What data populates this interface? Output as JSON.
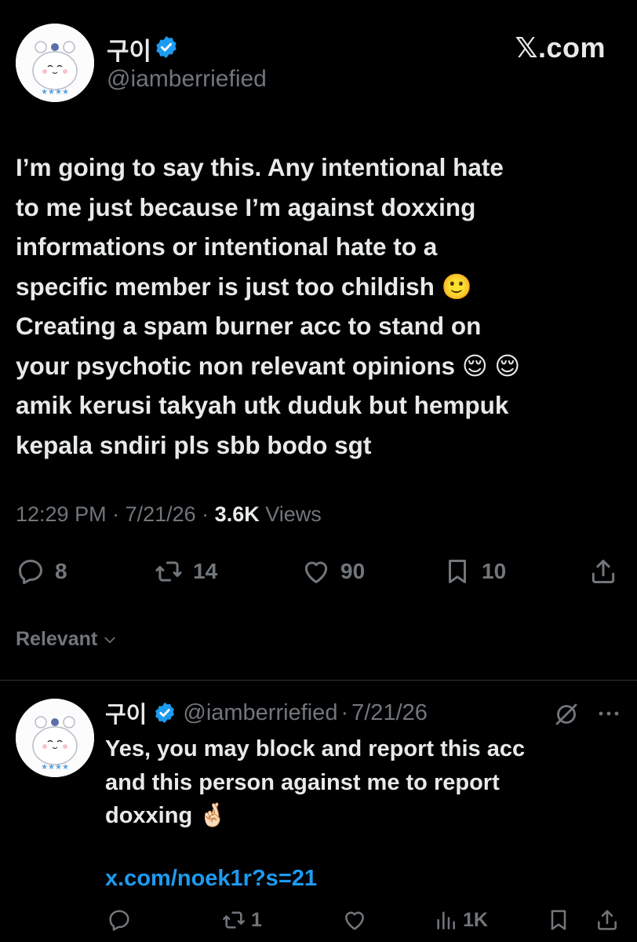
{
  "colors": {
    "background": "#000000",
    "text_primary": "#e7e9ea",
    "text_secondary": "#71767b",
    "verified_blue": "#1d9bf0",
    "link_blue": "#1d9bf0",
    "divider": "#2f3336"
  },
  "header": {
    "brand": "𝕏.com",
    "user": {
      "display_name": "구이",
      "handle": "@iamberriefied",
      "avatar_icon": "bear-avatar-icon",
      "verified_icon": "verified-badge-icon"
    }
  },
  "tweet": {
    "lines": [
      "I’m going to say this. Any intentional hate",
      "to me just because I’m against doxxing",
      "informations or intentional hate to a",
      "specific member is just too childish 🙂",
      "Creating a spam burner acc to stand on",
      "your psychotic non relevant opinions 😌 😌",
      "amik kerusi takyah utk duduk but hempuk",
      "kepala sndiri pls sbb bodo sgt"
    ],
    "time": "12:29 PM",
    "separator": " · ",
    "date": "7/21/26",
    "views_count": "3.6K",
    "views_label": "Views",
    "actions": {
      "replies": "8",
      "reposts": "14",
      "likes": "90",
      "bookmarks": "10"
    }
  },
  "sort": {
    "label": "Relevant"
  },
  "reply": {
    "display_name": "구이",
    "handle": "@iamberriefied",
    "dot": "·",
    "date": "7/21/26",
    "lines": [
      "Yes, you may block and report this acc",
      "and this person against me to report",
      "doxxing 🤞🏻"
    ],
    "link": "x.com/noek1r?s=21",
    "actions": {
      "reposts": "1",
      "views": "1K"
    }
  }
}
